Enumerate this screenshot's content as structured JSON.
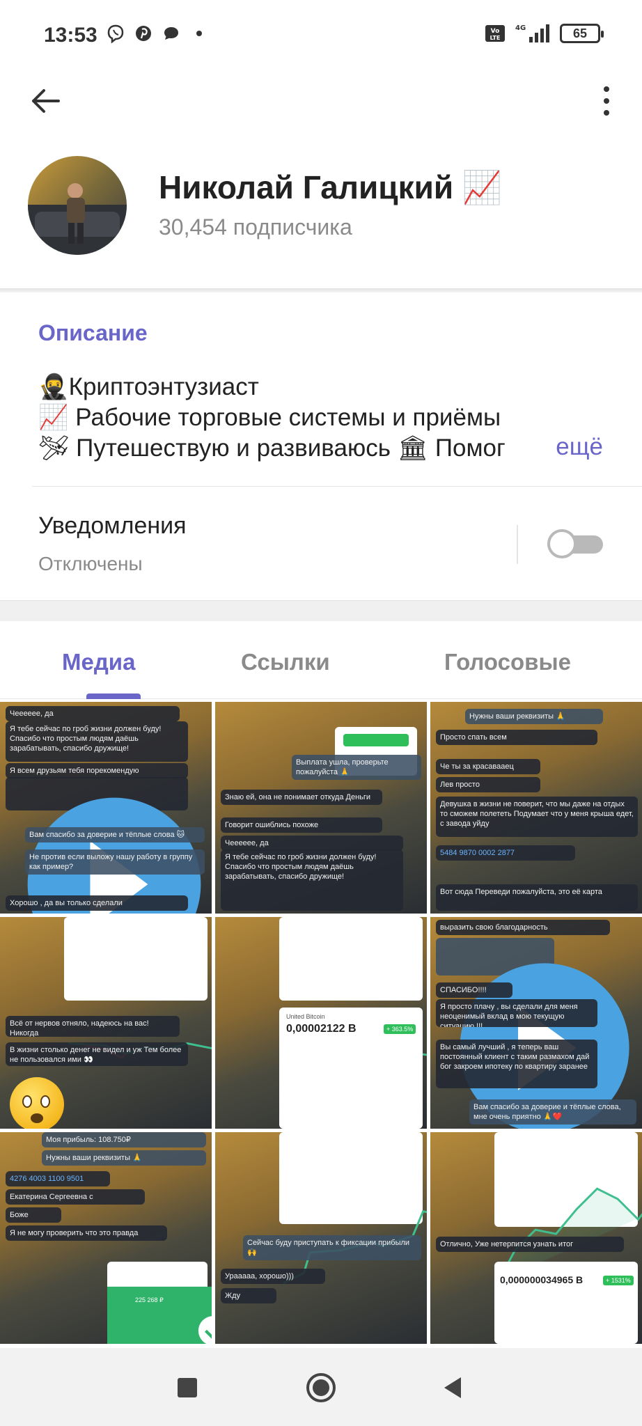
{
  "status_bar": {
    "time": "13:53",
    "battery": "65",
    "network": "4G",
    "icons_left": [
      "viber-icon",
      "pinterest-icon",
      "chat-bubble-icon"
    ],
    "icons_right": [
      "volte-icon",
      "signal-icon",
      "battery-icon"
    ]
  },
  "header": {
    "channel_name": "Николай Галицкий 📈",
    "subscribers": "30,454 подписчика"
  },
  "description": {
    "title": "Описание",
    "lines": [
      "🥷Криптоэнтузиаст",
      "📈 Рабочие торговые системы и приёмы",
      "🛩 Путешествую и развиваюсь 🏛 Помог"
    ],
    "more": "ещё"
  },
  "notifications": {
    "title": "Уведомления",
    "status": "Отключены",
    "enabled": false
  },
  "tabs": [
    {
      "label": "Медиа",
      "active": true
    },
    {
      "label": "Ссылки",
      "active": false
    },
    {
      "label": "Голосовые",
      "active": false
    }
  ],
  "media": {
    "t1": {
      "b1": "Чееееее, да",
      "b2": "Я тебе сейчас по гроб жизни должен буду! Спасибо что простым людям даёшь зарабатывать, спасибо дружище!",
      "b3": "Я всем друзьям тебя порекомендую",
      "b4": "Вам спасибо за доверие и тёплые слова 🐱",
      "b5": "Не против если выложу нашу работу в группу как пример?",
      "b6": "Хорошо , да вы только сделали"
    },
    "t2": {
      "b1": "Выплата ушла, проверьте пожалуйста 🙏",
      "b2": "Знаю ей, она не понимает откуда Деньги",
      "b3": "Говорит ошиблись похоже",
      "b4": "Чееееее, да",
      "b5": "Я тебе сейчас по гроб жизни должен буду! Спасибо что простым людям даёшь зарабатывать, спасибо дружище!"
    },
    "t3": {
      "b1": "Нужны ваши реквизиты 🙏",
      "b2": "Просто спать всем",
      "b3": "Че ты за красавааец",
      "b4": "Лев просто",
      "b5": "Девушка в жизни не поверит, что мы даже на отдых то сможем полететь Подумает что у меня крыша едет, с завода уйду",
      "b6": "5484 9870 0002 2877",
      "b7": "Вот сюда Переведи пожалуйста, это её карта"
    },
    "t4": {
      "b1": "Всё от нервов отняло, надеюсь на вас! Никогда",
      "b2": "В жизни столько денег не видел и уж Тем более не пользовался ими 👀"
    },
    "t5": {
      "title": "United Bitcoin",
      "value": "0,00002122 B",
      "change": "+ 363.5%"
    },
    "t6": {
      "b1": "выразить свою благодарность",
      "b2": "СПАСИБО!!!!",
      "b3": "Я просто плачу , вы сделали для меня неоценимый вклад в мою текущую ситуацию !!!",
      "b4": "Вы самый лучший , я теперь ваш постоянный клиент с таким размахом дай бог закроем ипотеку по квартиру заранее",
      "b5": "Вам спасибо за доверие и тёплые слова, мне очень приятно 🙏❤️"
    },
    "t7": {
      "b1": "Моя прибыль: 108.750₽",
      "b2": "Нужны ваши реквизиты 🙏",
      "b3": "4276 4003 1100 9501",
      "b4": "Екатерина Сергеевна с",
      "b5": "Боже",
      "b6": "Я не могу проверить что это правда",
      "amount": "225 268 ₽"
    },
    "t8": {
      "b1": "Сейчас буду приступать к фиксации прибыли 🙌",
      "b2": "Урааааа, хорошо)))",
      "b3": "Жду"
    },
    "t9": {
      "b1": "Отлично, Уже нетерпится узнать итог",
      "value": "0,000000034965 B",
      "change": "+ 1531%"
    }
  },
  "nav": [
    "recents-button",
    "home-button",
    "back-button"
  ],
  "colors": {
    "accent": "#6a66c9",
    "secondary_text": "#8a8a8a",
    "chart_green": "#3fbf8f"
  }
}
